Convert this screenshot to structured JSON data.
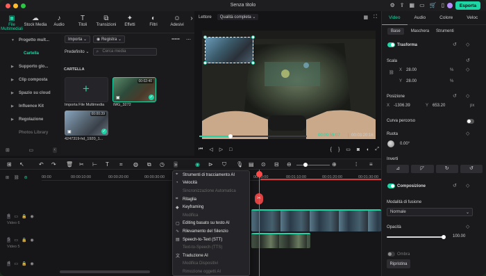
{
  "window": {
    "title": "Senza titolo",
    "export_label": "Esporta"
  },
  "media_tabs": [
    {
      "label": "File Multimediali",
      "icon": "folder-icon"
    },
    {
      "label": "Stock Media",
      "icon": "cloud-icon"
    },
    {
      "label": "Audio",
      "icon": "music-icon"
    },
    {
      "label": "Titoli",
      "icon": "text-icon"
    },
    {
      "label": "Transizioni",
      "icon": "transition-icon"
    },
    {
      "label": "Effetti",
      "icon": "effects-icon"
    },
    {
      "label": "Filtri",
      "icon": "filter-icon"
    },
    {
      "label": "Adesivi",
      "icon": "sticker-icon"
    }
  ],
  "sidebar": {
    "items": [
      {
        "label": "Progetto mult..."
      },
      {
        "label": "Cartella"
      },
      {
        "label": "Supporto glo..."
      },
      {
        "label": "Clip composta"
      },
      {
        "label": "Spazio su cloud"
      },
      {
        "label": "Influence Kit"
      },
      {
        "label": "Regolazione"
      },
      {
        "label": "Photos Library"
      }
    ]
  },
  "media": {
    "import_label": "Importa",
    "record_label": "Registra",
    "sort_label": "Predefinito",
    "search_placeholder": "Cerca media",
    "folder_label": "CARTELLA",
    "items": [
      {
        "label": "Importa File Multimedia",
        "duration": ""
      },
      {
        "label": "IMG_3272",
        "duration": "00:02:40"
      },
      {
        "label": "4247319-hd_1920_1...",
        "duration": "00:00:39"
      }
    ]
  },
  "player": {
    "mode_label": "Lettore",
    "quality_label": "Qualità completa",
    "current_time": "00:00:59:07",
    "total_time": "00:03:20:16",
    "progress": 0.29
  },
  "right_panel": {
    "tabs": [
      "Video",
      "Audio",
      "Colore",
      "Veloc"
    ],
    "subtabs": [
      "Base",
      "Maschera",
      "Strumenti"
    ],
    "transform_label": "Trasforma",
    "scale_label": "Scala",
    "scale_x": "28.00",
    "scale_y": "28.00",
    "scale_unit": "%",
    "position_label": "Posizione",
    "pos_x": "-1306.39",
    "pos_y": "653.20",
    "pos_unit": "px",
    "curve_label": "Curva percorso",
    "rotate_label": "Ruota",
    "rotate_value": "0.00°",
    "invert_label": "Inverti",
    "composition_label": "Composizione",
    "blend_label": "Modalità di fusione",
    "blend_value": "Normale",
    "opacity_label": "Opacità",
    "opacity_value": "100.00",
    "reset_label": "Ripristina",
    "x_label": "X",
    "y_label": "Y",
    "shadow_label": "Ombra"
  },
  "timeline": {
    "ruler": [
      "00:00",
      "00:00:10:00",
      "00:00:20:00",
      "00:00:30:00",
      "00:00:00",
      "00:01:10:00",
      "00:01:20:00",
      "00:01:30:00"
    ],
    "tracks": [
      {
        "label": "Video 6",
        "num": "6"
      },
      {
        "label": "Video 5",
        "num": "5"
      },
      {
        "label": "",
        "num": "4"
      }
    ]
  },
  "context_menu": {
    "items": [
      {
        "label": "Strumenti di tracciamento AI",
        "enabled": true
      },
      {
        "label": "Velocità",
        "enabled": true
      },
      {
        "label": "Sincronizzazione Automatica",
        "enabled": false
      },
      {
        "label": "Ritaglia",
        "enabled": true
      },
      {
        "label": "Keyframing",
        "enabled": true
      },
      {
        "label": "Modifica",
        "enabled": false
      },
      {
        "label": "Editing basato su testo AI",
        "enabled": true
      },
      {
        "label": "Rilevamento del Silenzio",
        "enabled": true
      },
      {
        "label": "Speech-to-Text (STT)",
        "enabled": true
      },
      {
        "label": "Text-to-Speech (TTS)",
        "enabled": false
      },
      {
        "label": "Traduzione AI",
        "enabled": true
      },
      {
        "label": "Modifica Dispositivi",
        "enabled": false
      },
      {
        "label": "Rimozione oggetti AI",
        "enabled": false
      }
    ]
  },
  "colors": {
    "accent": "#1ed6a5",
    "playhead": "#ff4a4a"
  }
}
